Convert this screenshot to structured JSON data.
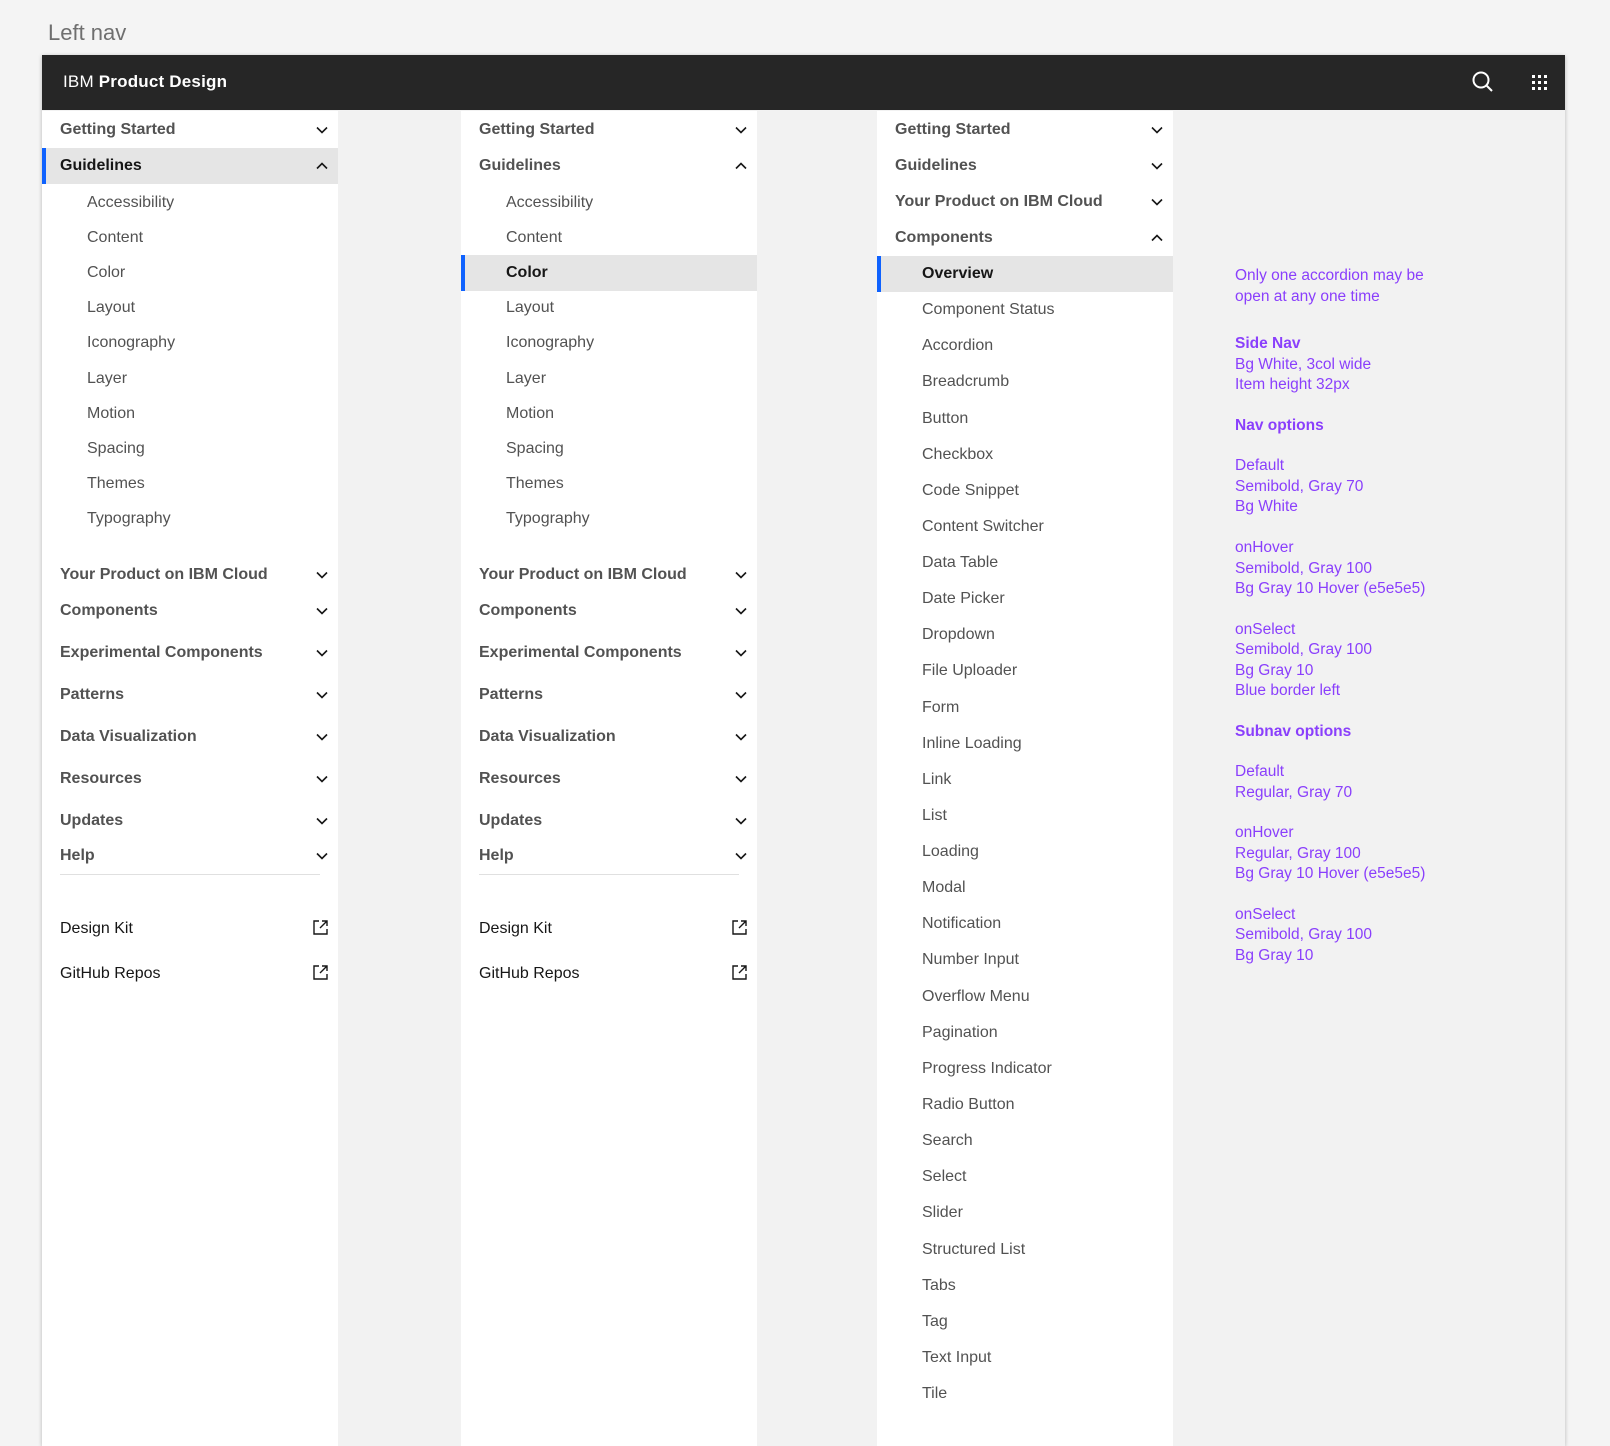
{
  "section_label": "Left nav",
  "header": {
    "brand_prefix": "IBM ",
    "brand_name": "Product Design",
    "icons": [
      "search-icon",
      "app-switcher-icon"
    ]
  },
  "nav1": {
    "top_items": [
      {
        "label": "Getting Started",
        "state": "collapsed"
      },
      {
        "label": "Guidelines",
        "state": "expanded",
        "selected": true
      }
    ],
    "sub_items": [
      "Accessibility",
      "Content",
      "Color",
      "Layout",
      "Iconography",
      "Layer",
      "Motion",
      "Spacing",
      "Themes",
      "Typography"
    ],
    "bottom_items": [
      "Your Product on IBM Cloud",
      "Components",
      "Experimental Components",
      "Patterns",
      "Data Visualization",
      "Resources",
      "Updates",
      "Help"
    ],
    "links": [
      "Design Kit",
      "GitHub Repos"
    ]
  },
  "nav2": {
    "top_items": [
      {
        "label": "Getting Started",
        "state": "collapsed"
      },
      {
        "label": "Guidelines",
        "state": "expanded"
      }
    ],
    "sub_items": [
      "Accessibility",
      "Content",
      "Color",
      "Layout",
      "Iconography",
      "Layer",
      "Motion",
      "Spacing",
      "Themes",
      "Typography"
    ],
    "selected_sub": "Color",
    "bottom_items": [
      "Your Product on IBM Cloud",
      "Components",
      "Experimental Components",
      "Patterns",
      "Data Visualization",
      "Resources",
      "Updates",
      "Help"
    ],
    "links": [
      "Design Kit",
      "GitHub Repos"
    ]
  },
  "nav3": {
    "top_items": [
      {
        "label": "Getting Started",
        "state": "collapsed"
      },
      {
        "label": "Guidelines",
        "state": "collapsed"
      },
      {
        "label": "Your Product on IBM Cloud",
        "state": "collapsed"
      },
      {
        "label": "Components",
        "state": "expanded"
      }
    ],
    "sub_items": [
      "Overview",
      "Component Status",
      "Accordion",
      "Breadcrumb",
      "Button",
      "Checkbox",
      "Code Snippet",
      "Content Switcher",
      "Data Table",
      "Date Picker",
      "Dropdown",
      "File Uploader",
      "Form",
      "Inline Loading",
      "Link",
      "List",
      "Loading",
      "Modal",
      "Notification",
      "Number Input",
      "Overflow Menu",
      "Pagination",
      "Progress Indicator",
      "Radio Button",
      "Search",
      "Select",
      "Slider",
      "Structured List",
      "Tabs",
      "Tag",
      "Text Input",
      "Tile"
    ],
    "selected_sub": "Overview"
  },
  "notes": [
    {
      "text": "Only one accordion may be",
      "bold": false
    },
    {
      "text": "open at any one time",
      "bold": false
    },
    {
      "text": "Side Nav",
      "bold": true
    },
    {
      "text": "Bg White, 3col wide",
      "bold": false
    },
    {
      "text": "Item height 32px",
      "bold": false
    },
    {
      "text": "Nav options",
      "bold": true
    },
    {
      "text": "Default",
      "bold": false
    },
    {
      "text": "Semibold, Gray 70",
      "bold": false
    },
    {
      "text": "Bg White",
      "bold": false
    },
    {
      "text": "onHover",
      "bold": false
    },
    {
      "text": "Semibold, Gray 100",
      "bold": false
    },
    {
      "text": "Bg Gray 10 Hover (e5e5e5)",
      "bold": false
    },
    {
      "text": "onSelect",
      "bold": false
    },
    {
      "text": "Semibold, Gray 100",
      "bold": false
    },
    {
      "text": "Bg Gray 10",
      "bold": false
    },
    {
      "text": "Blue border left",
      "bold": false
    },
    {
      "text": "Subnav options",
      "bold": true
    },
    {
      "text": "Default",
      "bold": false
    },
    {
      "text": "Regular, Gray 70",
      "bold": false
    },
    {
      "text": "onHover",
      "bold": false
    },
    {
      "text": "Regular, Gray 100",
      "bold": false
    },
    {
      "text": "Bg Gray 10 Hover (e5e5e5)",
      "bold": false
    },
    {
      "text": "onSelect",
      "bold": false
    },
    {
      "text": "Semibold, Gray 100",
      "bold": false
    },
    {
      "text": "Bg Gray 10",
      "bold": false
    }
  ],
  "colors": {
    "header_bg": "#262626",
    "nav_bg": "#ffffff",
    "selected_bg": "#e5e5e5",
    "selected_border": "#0f62fe",
    "text_default": "#525252",
    "text_selected": "#161616",
    "annotation": "#8a3ffc",
    "canvas_bg": "#f2f2f2"
  }
}
